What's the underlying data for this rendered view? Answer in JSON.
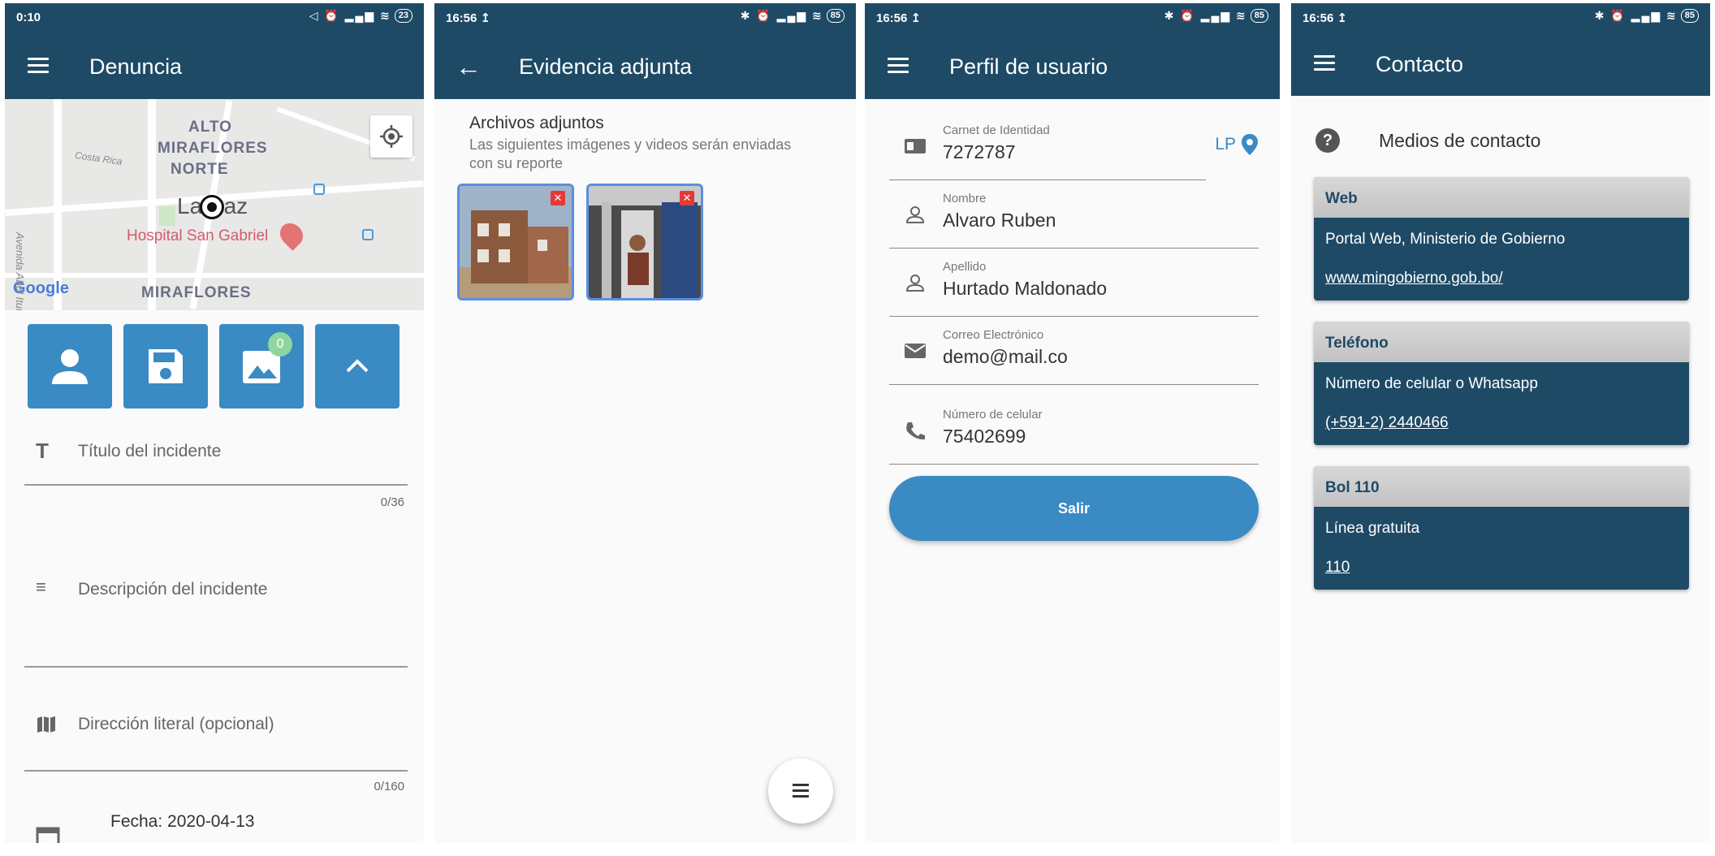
{
  "screens": {
    "denuncia": {
      "status": {
        "time": "0:10",
        "battery": "23"
      },
      "title": "Denuncia",
      "map": {
        "labels": [
          "ALTO",
          "MIRAFLORES",
          "NORTE",
          "La Paz",
          "Hospital San Gabriel",
          "MIRAFLORES",
          "Costa Rica",
          "Avenida Abel Iturralde"
        ],
        "google": "Google"
      },
      "badge_count": "0",
      "fields": {
        "titulo": "Título del incidente",
        "titulo_counter": "0/36",
        "descripcion": "Descripción del incidente",
        "direccion": "Dirección literal (opcional)",
        "direccion_counter": "0/160",
        "fecha": "Fecha: 2020-04-13"
      }
    },
    "evidencia": {
      "status": {
        "time": "16:56",
        "battery": "85"
      },
      "title": "Evidencia adjunta",
      "heading": "Archivos adjuntos",
      "subheading": "Las siguientes imágenes y videos serán enviadas con su reporte"
    },
    "perfil": {
      "status": {
        "time": "16:56",
        "battery": "85"
      },
      "title": "Perfil de usuario",
      "ci_label": "Carnet de Identidad",
      "ci_value": "7272787",
      "ci_dept": "LP",
      "nombre_label": "Nombre",
      "nombre_value": "Alvaro Ruben",
      "apellido_label": "Apellido",
      "apellido_value": "Hurtado Maldonado",
      "correo_label": "Correo Electrónico",
      "correo_value": "demo@mail.co",
      "celular_label": "Número de celular",
      "celular_value": "75402699",
      "salir": "Salir"
    },
    "contacto": {
      "status": {
        "time": "16:56",
        "battery": "85"
      },
      "title": "Contacto",
      "medios": "Medios de contacto",
      "cards": [
        {
          "header": "Web",
          "body": "Portal Web, Ministerio de Gobierno",
          "link": "www.mingobierno.gob.bo/"
        },
        {
          "header": "Teléfono",
          "body": "Número de celular o Whatsapp",
          "link": "(+591-2) 2440466"
        },
        {
          "header": "Bol 110",
          "body": "Línea gratuita",
          "link": "110"
        }
      ]
    }
  },
  "colors": {
    "primary": "#1e4a66",
    "accent": "#3a8ac4",
    "badge": "#8ed6a0",
    "delete": "#e53935"
  }
}
